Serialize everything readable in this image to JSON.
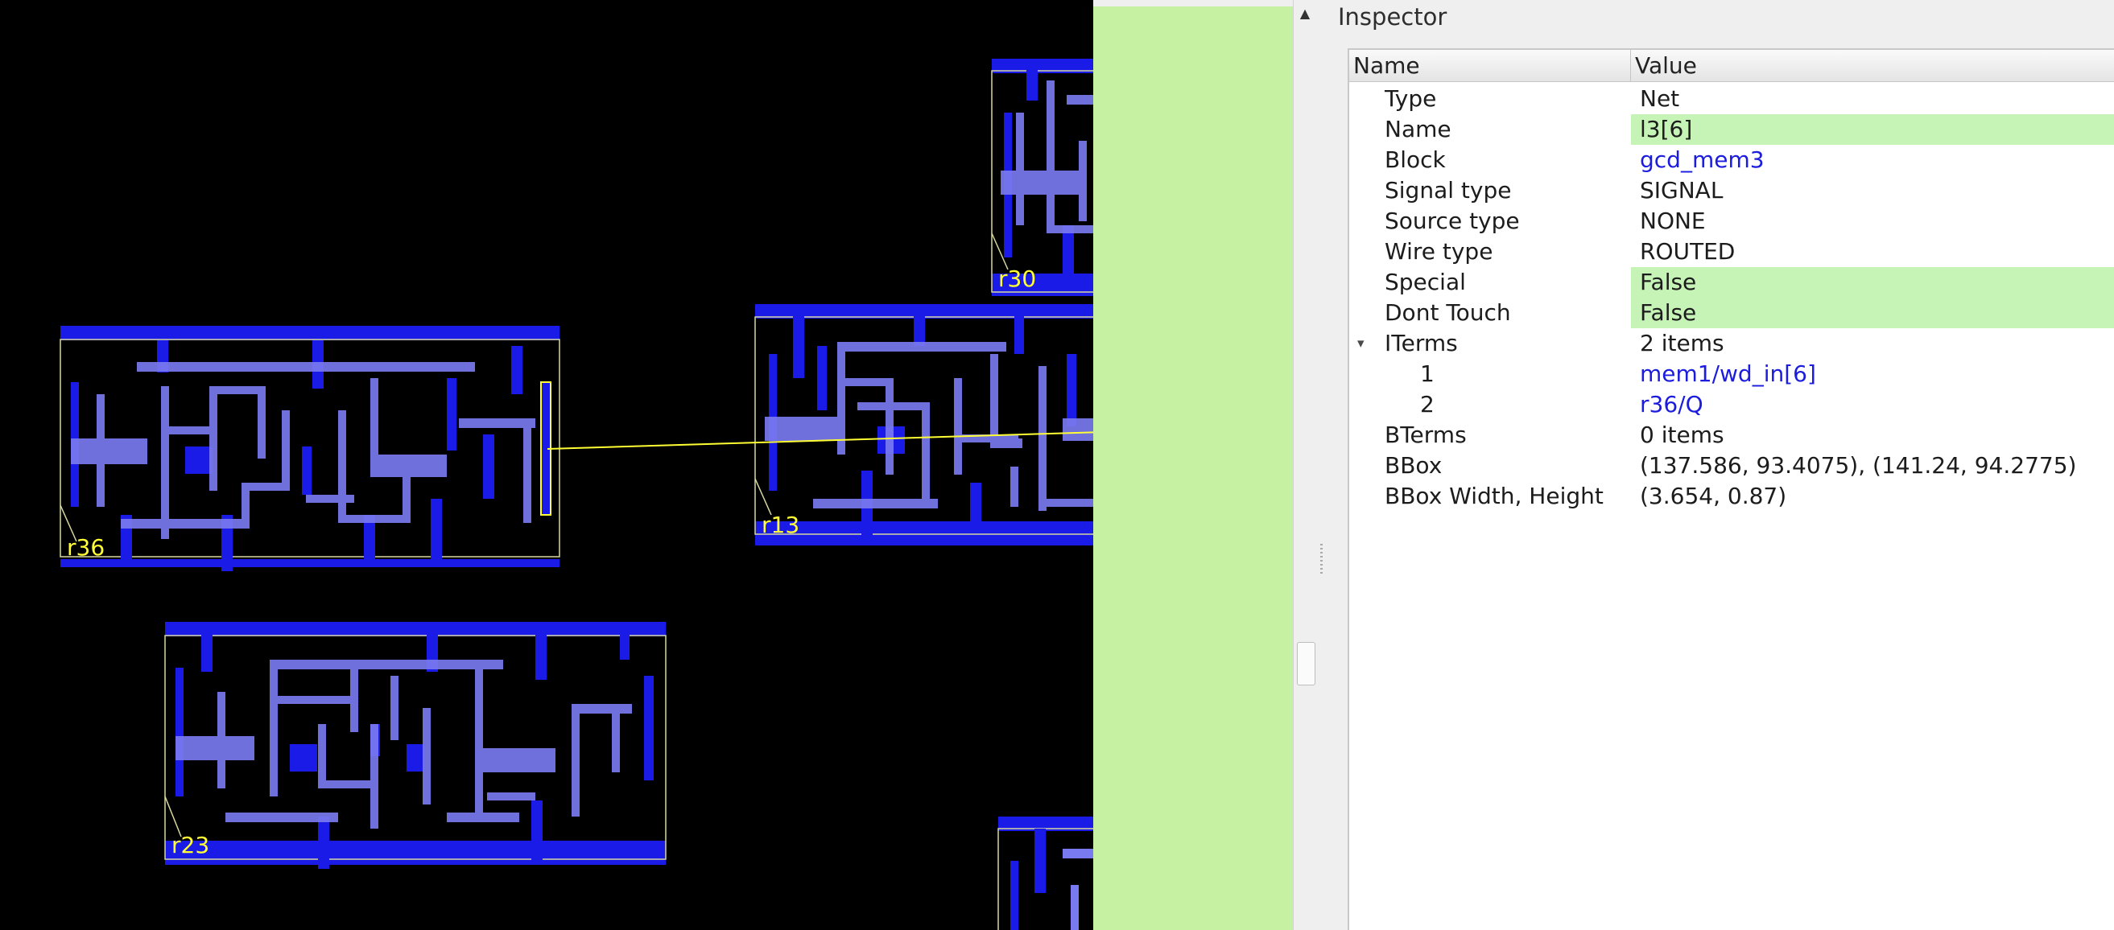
{
  "layout": {
    "instances": [
      {
        "label": "r36"
      },
      {
        "label": "r13"
      },
      {
        "label": "r30"
      },
      {
        "label": "r23"
      }
    ],
    "colors": {
      "background": "#000000",
      "metal_rail": "#1b1be8",
      "metal_route": "#7a7af0",
      "highlight": "#ffff33",
      "selection_overlay": "#c6f1a3"
    }
  },
  "scrollbar": {
    "up_arrow_icon": "▲"
  },
  "inspector": {
    "title": "Inspector",
    "columns": {
      "name": "Name",
      "value": "Value"
    },
    "rows": [
      {
        "name": "Type",
        "value": "Net"
      },
      {
        "name": "Name",
        "value": "l3[6]"
      },
      {
        "name": "Block",
        "value": "gcd_mem3"
      },
      {
        "name": "Signal type",
        "value": "SIGNAL"
      },
      {
        "name": "Source type",
        "value": "NONE"
      },
      {
        "name": "Wire type",
        "value": "ROUTED"
      },
      {
        "name": "Special",
        "value": "False"
      },
      {
        "name": "Dont Touch",
        "value": "False"
      },
      {
        "name": "ITerms",
        "value": "2 items"
      },
      {
        "name": "1",
        "value": "mem1/wd_in[6]"
      },
      {
        "name": "2",
        "value": "r36/Q"
      },
      {
        "name": "BTerms",
        "value": "0 items"
      },
      {
        "name": "BBox",
        "value": "(137.586, 93.4075), (141.24, 94.2775)"
      },
      {
        "name": "BBox Width, Height",
        "value": "(3.654, 0.87)"
      }
    ],
    "expander_icon": "▾",
    "highlight_color": "#c6f3b6",
    "link_color": "#1c1cde"
  }
}
